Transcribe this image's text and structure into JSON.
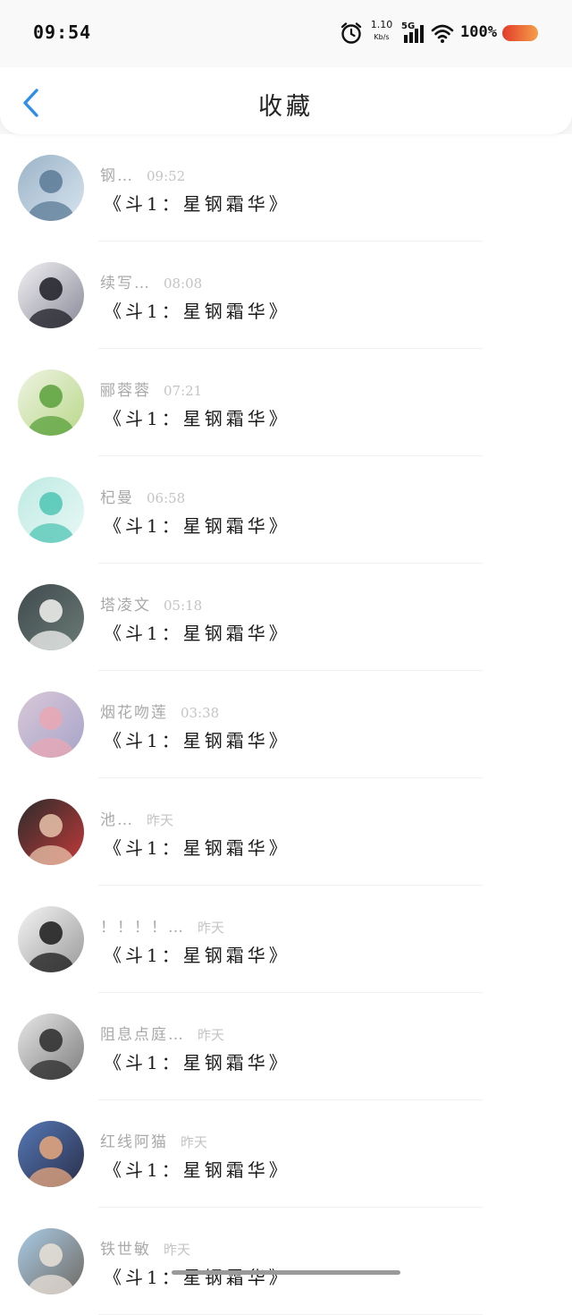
{
  "status_bar": {
    "time": "09:54",
    "net_speed_value": "1.10",
    "net_speed_unit": "Kb/s",
    "signal_label": "5G",
    "battery": "100%",
    "battery_color": "#e85b2e"
  },
  "header": {
    "title": "收藏",
    "back_icon": "chevron-left-icon",
    "accent": "#2f8ee8"
  },
  "favorites": [
    {
      "name": "钢…",
      "time": "09:52",
      "text": "《斗1：星钢霜华》",
      "colors": [
        "#9bb4c8",
        "#5a7a96",
        "#d7e3ee"
      ]
    },
    {
      "name": "续写…",
      "time": "08:08",
      "text": "《斗1：星钢霜华》",
      "colors": [
        "#f1f1f3",
        "#1c1c24",
        "#8a8a99"
      ]
    },
    {
      "name": "郦蓉蓉",
      "time": "07:21",
      "text": "《斗1：星钢霜华》",
      "colors": [
        "#eef3e2",
        "#5aa03c",
        "#b9d88a"
      ]
    },
    {
      "name": "杞曼",
      "time": "06:58",
      "text": "《斗1：星钢霜华》",
      "colors": [
        "#bfeae3",
        "#4fc6b4",
        "#e8f8f5"
      ]
    },
    {
      "name": "塔凌文",
      "time": "05:18",
      "text": "《斗1：星钢霜华》",
      "colors": [
        "#3f4a4d",
        "#f3f3f1",
        "#6b7a76"
      ]
    },
    {
      "name": "烟花吻莲",
      "time": "03:38",
      "text": "《斗1：星钢霜华》",
      "colors": [
        "#d9c8d8",
        "#e9a7b4",
        "#a7a4c9"
      ]
    },
    {
      "name": "池…",
      "time": "昨天",
      "text": "《斗1：星钢霜华》",
      "colors": [
        "#2b2b2b",
        "#e8c3aa",
        "#c23a3a"
      ]
    },
    {
      "name": "！！！！…",
      "time": "昨天",
      "text": "《斗1：星钢霜华》",
      "colors": [
        "#f5f5f5",
        "#1a1a1a",
        "#9a9a9a"
      ]
    },
    {
      "name": "阻息点庭…",
      "time": "昨天",
      "text": "《斗1：星钢霜华》",
      "colors": [
        "#e8e8e8",
        "#2a2a2a",
        "#7d7d7d"
      ]
    },
    {
      "name": "红线阿猫",
      "time": "昨天",
      "text": "《斗1：星钢霜华》",
      "colors": [
        "#5578b6",
        "#e7a77d",
        "#2a2f4a"
      ]
    },
    {
      "name": "铁世敏",
      "time": "昨天",
      "text": "《斗1：星钢霜华》",
      "colors": [
        "#a9cbe6",
        "#e9e2d8",
        "#6f6a62"
      ]
    }
  ]
}
